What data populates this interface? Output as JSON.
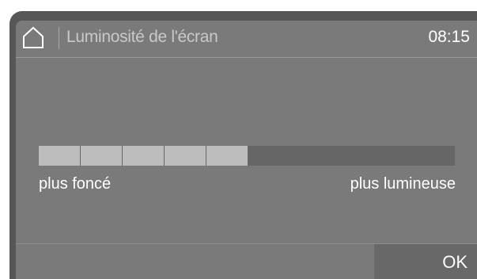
{
  "header": {
    "title": "Luminosité de l'écran",
    "time": "08:15",
    "home_icon": "home-icon"
  },
  "brightness": {
    "level": 5,
    "max_level": 10,
    "label_min": "plus foncé",
    "label_max": "plus lumineuse"
  },
  "footer": {
    "ok_label": "OK"
  },
  "colors": {
    "bezel": "#575757",
    "screen": "#7a7a7a",
    "segment_filled": "#bdbdbd",
    "track": "#666666",
    "ok_button": "#686868"
  }
}
